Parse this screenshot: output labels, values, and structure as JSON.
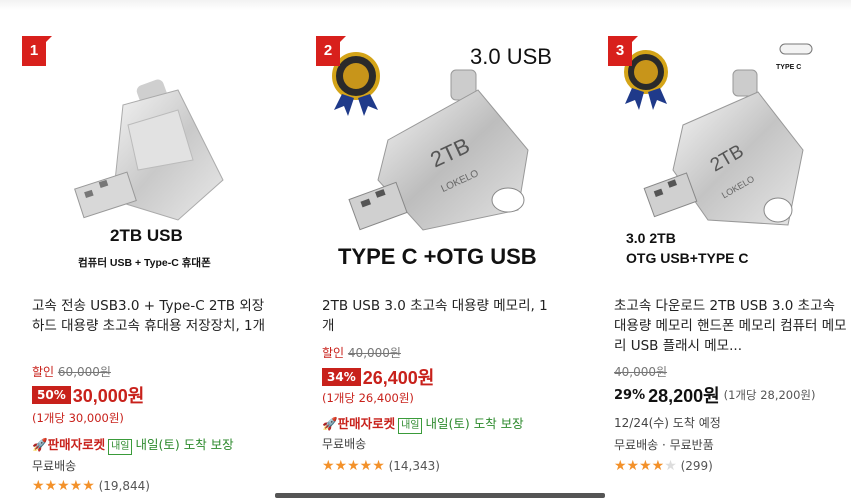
{
  "products": [
    {
      "rank": "1",
      "image_caption_main": "2TB USB",
      "image_caption_sub": "컴퓨터 USB + Type-C 휴대폰",
      "title": "고속 전송 USB3.0 + Type-C 2TB 외장하드 대용량 초고속 휴대용 저장장치, 1개",
      "discount_label": "할인",
      "original_price": "60,000원",
      "discount_percent": "50%",
      "price": "30,000원",
      "unit_price": "(1개당 30,000원)",
      "rocket_label": "🚀판매자로켓",
      "tomorrow_badge": "내일",
      "delivery_text": "내일(토) 도착 보장",
      "shipping": "무료배송",
      "rating_stars": 5,
      "reviews": "(19,844)"
    },
    {
      "rank": "2",
      "image_caption_top": "3.0 USB",
      "image_caption_main": "TYPE C +OTG USB",
      "image_device_text": "2TB",
      "image_brand_text": "LOKELO",
      "title": "2TB USB 3.0 초고속 대용량 메모리, 1개",
      "discount_label": "할인",
      "original_price": "40,000원",
      "discount_percent": "34%",
      "price": "26,400원",
      "unit_price": "(1개당 26,400원)",
      "rocket_label": "🚀판매자로켓",
      "tomorrow_badge": "내일",
      "delivery_text": "내일(토) 도착 보장",
      "shipping": "무료배송",
      "rating_stars": 5,
      "reviews": "(14,343)"
    },
    {
      "rank": "3",
      "image_caption_main": "3.0 2TB",
      "image_caption_sub": "OTG USB+TYPE C",
      "image_corner_label": "TYPE C",
      "image_device_text": "2TB",
      "image_brand_text": "LOKELO",
      "title": "초고속 다운로드 2TB USB 3.0 초고속 대용량 메모리 핸드폰 메모리 컴퓨터 메모리 USB 플래시 메모...",
      "original_price": "40,000원",
      "discount_percent": "29%",
      "price": "28,200원",
      "unit_price": "(1개당 28,200원)",
      "delivery_text": "12/24(수) 도착 예정",
      "shipping": "무료배송 · 무료반품",
      "rating_stars": 4,
      "reviews": "(299)"
    }
  ],
  "colors": {
    "accent_red": "#c8211b",
    "delivery_green": "#2d8a2d",
    "star_orange": "#f3912a"
  }
}
